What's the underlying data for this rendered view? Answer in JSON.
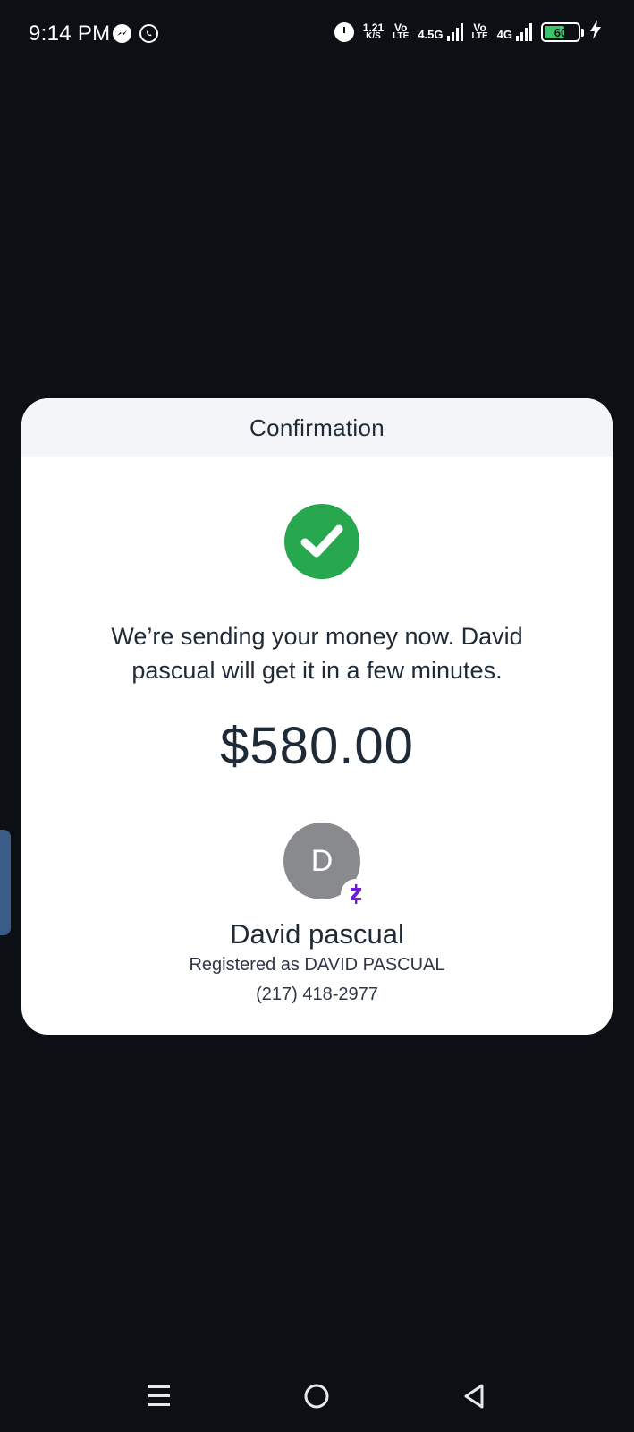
{
  "status_bar": {
    "time": "9:14 PM",
    "net_speed_value": "1.21",
    "net_speed_unit": "K/S",
    "sim1_volte_top": "Vo",
    "sim1_volte_bottom": "LTE",
    "sim1_network": "4.5G",
    "sim2_volte_top": "Vo",
    "sim2_volte_bottom": "LTE",
    "sim2_network": "4G",
    "battery_level": "60",
    "battery_fraction": 0.6,
    "battery_color": "#3cc46a",
    "icons": [
      "messenger-icon",
      "whatsapp-icon",
      "alarm-icon",
      "signal-icon",
      "battery-icon",
      "charging-icon"
    ]
  },
  "card": {
    "title": "Confirmation",
    "message": "We’re sending your money now. David pascual will get it in a few minutes.",
    "amount": "$580.00",
    "avatar_initial": "D",
    "recipient_name": "David pascual",
    "registered_as": "Registered as DAVID PASCUAL",
    "phone": "(217) 418-2977",
    "colors": {
      "success": "#27a84f",
      "zelle": "#6d1ed4",
      "avatar": "#888a8e"
    }
  },
  "nav": {
    "items": [
      "recent-apps-icon",
      "home-icon",
      "back-icon"
    ]
  }
}
